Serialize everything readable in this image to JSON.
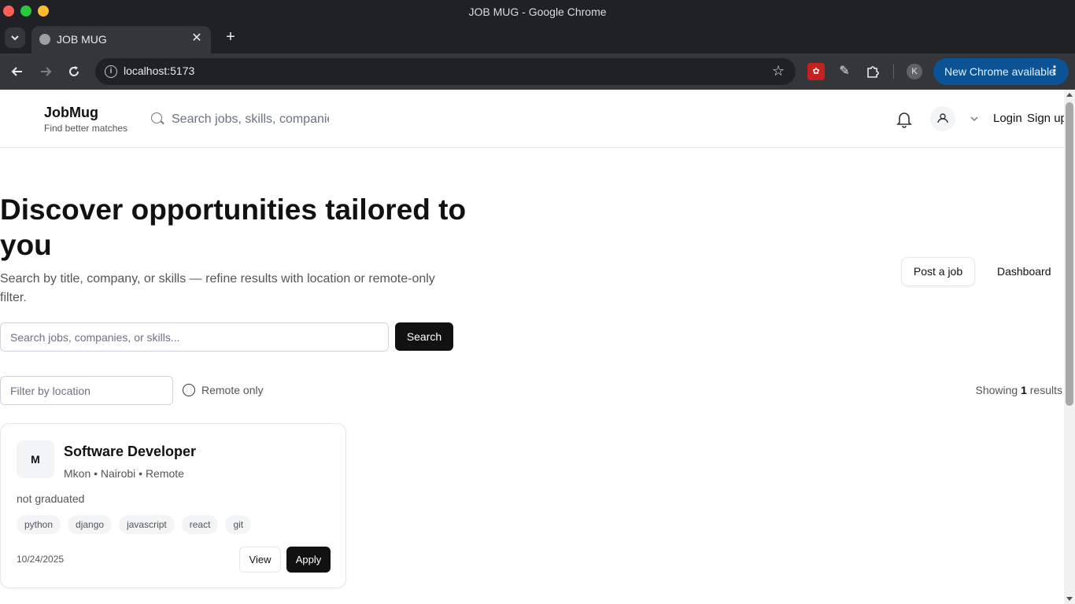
{
  "window": {
    "title": "JOB MUG - Google Chrome"
  },
  "browser": {
    "tab_title": "JOB MUG",
    "tab_close": "✕",
    "new_tab": "+",
    "url": "localhost:5173",
    "profile_initial": "K",
    "update_label": "New Chrome available",
    "update_menu": "⋮",
    "icons": {
      "tab_search": "chevron-down-icon",
      "back": "back-arrow-icon",
      "forward": "forward-arrow-icon",
      "reload": "reload-icon",
      "site_info": "info-icon",
      "bookmark": "star-icon",
      "extensions": [
        "ladybug-extension-icon",
        "pen-extension-icon",
        "puzzle-icon"
      ]
    }
  },
  "site_header": {
    "brand_name": "JobMug",
    "brand_tagline": "Find better matches",
    "search_placeholder": "Search jobs, skills, companies",
    "login_label": "Login",
    "signup_label": "Sign up"
  },
  "hero": {
    "title": "Discover opportunities tailored to you",
    "subtitle": "Search by title, company, or skills — refine results with location or remote-only filter.",
    "post_job_label": "Post a job",
    "dashboard_label": "Dashboard"
  },
  "search": {
    "placeholder": "Search jobs, companies, or skills...",
    "button_label": "Search"
  },
  "filters": {
    "location_placeholder": "Filter by location",
    "remote_label": "Remote only",
    "remote_checked": false,
    "results_prefix": "Showing",
    "results_count": "1",
    "results_suffix": "results"
  },
  "jobs": [
    {
      "avatar_letter": "M",
      "title": "Software Developer",
      "meta": "Mkon • Nairobi • Remote",
      "description": "not graduated",
      "tags": [
        "python",
        "django",
        "javascript",
        "react",
        "git"
      ],
      "date": "10/24/2025",
      "view_label": "View",
      "apply_label": "Apply"
    }
  ]
}
